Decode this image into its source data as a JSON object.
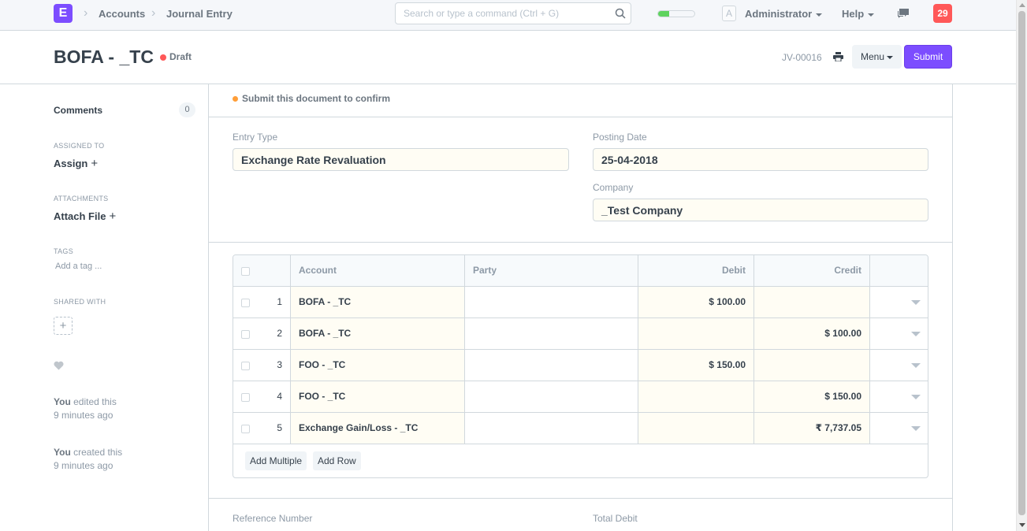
{
  "navbar": {
    "logo_letter": "E",
    "breadcrumbs": [
      "Accounts",
      "Journal Entry"
    ],
    "search_placeholder": "Search or type a command (Ctrl + G)",
    "progress": 0.3,
    "avatar_letter": "A",
    "user_label": "Administrator",
    "help_label": "Help",
    "notification_count": "29"
  },
  "page_head": {
    "title": "BOFA - _TC",
    "status": "Draft",
    "doc_name": "JV-00016",
    "menu_label": "Menu",
    "submit_label": "Submit"
  },
  "sidebar": {
    "comments_label": "Comments",
    "comments_count": "0",
    "assigned_to_label": "ASSIGNED TO",
    "assign_label": "Assign",
    "attachments_label": "ATTACHMENTS",
    "attach_label": "Attach File",
    "tags_label": "TAGS",
    "add_tag_label": "Add a tag ...",
    "shared_with_label": "SHARED WITH",
    "activity": [
      {
        "who": "You",
        "what": " edited this",
        "when": "9 minutes ago"
      },
      {
        "who": "You",
        "what": " created this",
        "when": "9 minutes ago"
      }
    ]
  },
  "form": {
    "message": "Submit this document to confirm",
    "entry_type_label": "Entry Type",
    "entry_type_value": "Exchange Rate Revaluation",
    "posting_date_label": "Posting Date",
    "posting_date_value": "25-04-2018",
    "company_label": "Company",
    "company_value": "_Test Company",
    "reference_number_label": "Reference Number",
    "total_debit_label": "Total Debit"
  },
  "grid": {
    "columns": [
      "Account",
      "Party",
      "Debit",
      "Credit"
    ],
    "rows": [
      {
        "idx": "1",
        "account": "BOFA - _TC",
        "party": "",
        "debit": "$ 100.00",
        "credit": ""
      },
      {
        "idx": "2",
        "account": "BOFA - _TC",
        "party": "",
        "debit": "",
        "credit": "$ 100.00"
      },
      {
        "idx": "3",
        "account": "FOO - _TC",
        "party": "",
        "debit": "$ 150.00",
        "credit": ""
      },
      {
        "idx": "4",
        "account": "FOO - _TC",
        "party": "",
        "debit": "",
        "credit": "$ 150.00"
      },
      {
        "idx": "5",
        "account": "Exchange Gain/Loss - _TC",
        "party": "",
        "debit": "",
        "credit": "₹ 7,737.05"
      }
    ],
    "add_multiple_label": "Add Multiple",
    "add_row_label": "Add Row"
  },
  "colors": {
    "primary": "#7c4dff",
    "draft_indicator": "#ff5858",
    "message_indicator": "#ff9e38",
    "notification": "#ff5858",
    "progress": "#5ed35e"
  },
  "icons": [
    "search-icon",
    "chat-icon",
    "print-icon",
    "plus-icon",
    "heart-icon",
    "chevron-right-icon",
    "caret-down-icon"
  ]
}
